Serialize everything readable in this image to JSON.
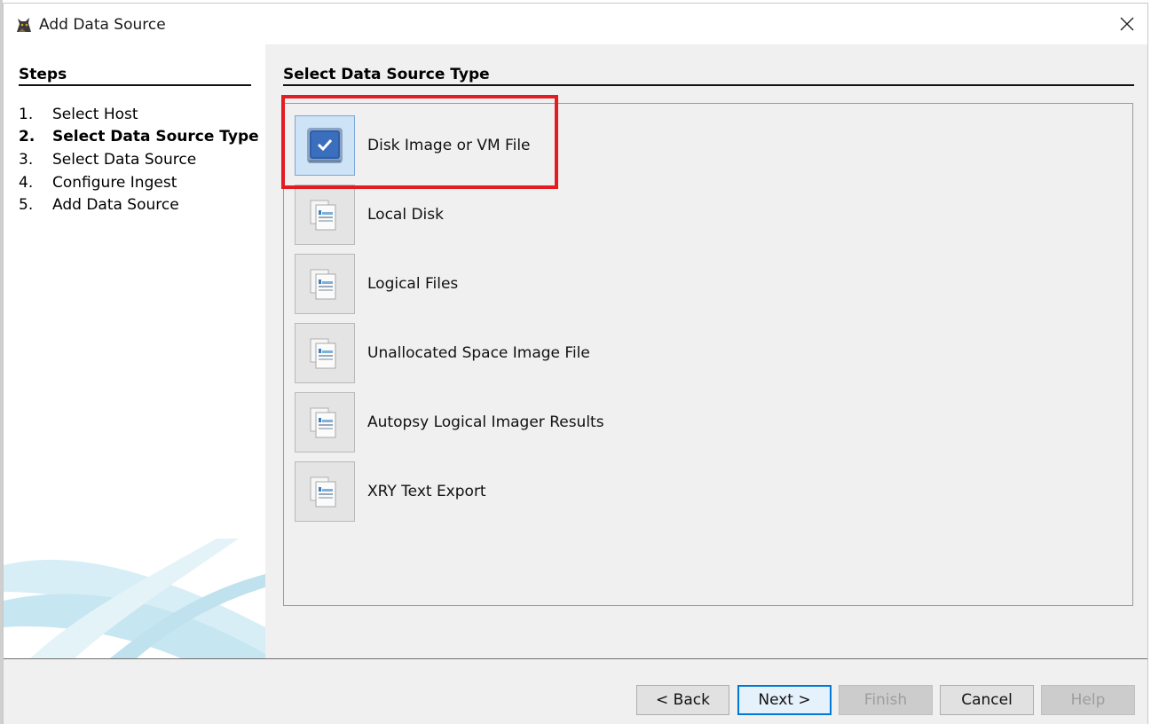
{
  "window": {
    "title": "Add Data Source",
    "app_icon": "autopsy-dog-icon",
    "close_icon": "close-icon"
  },
  "steps": {
    "title": "Steps",
    "items": [
      {
        "num": "1.",
        "label": "Select Host",
        "active": false
      },
      {
        "num": "2.",
        "label": "Select Data Source Type",
        "active": true
      },
      {
        "num": "3.",
        "label": "Select Data Source",
        "active": false
      },
      {
        "num": "4.",
        "label": "Configure Ingest",
        "active": false
      },
      {
        "num": "5.",
        "label": "Add Data Source",
        "active": false
      }
    ]
  },
  "main": {
    "title": "Select Data Source Type",
    "sources": [
      {
        "label": "Disk Image or VM File",
        "icon": "disk-image-icon",
        "selected": true
      },
      {
        "label": "Local Disk",
        "icon": "document-icon",
        "selected": false
      },
      {
        "label": "Logical Files",
        "icon": "document-icon",
        "selected": false
      },
      {
        "label": "Unallocated Space Image File",
        "icon": "document-icon",
        "selected": false
      },
      {
        "label": "Autopsy Logical Imager Results",
        "icon": "document-icon",
        "selected": false
      },
      {
        "label": "XRY Text Export",
        "icon": "document-icon",
        "selected": false
      }
    ]
  },
  "buttons": {
    "back": "< Back",
    "next": "Next >",
    "finish": "Finish",
    "cancel": "Cancel",
    "help": "Help"
  },
  "colors": {
    "highlight": "#e31b23",
    "selected_bg": "#cfe3f6",
    "default_button_border": "#0078d7"
  }
}
